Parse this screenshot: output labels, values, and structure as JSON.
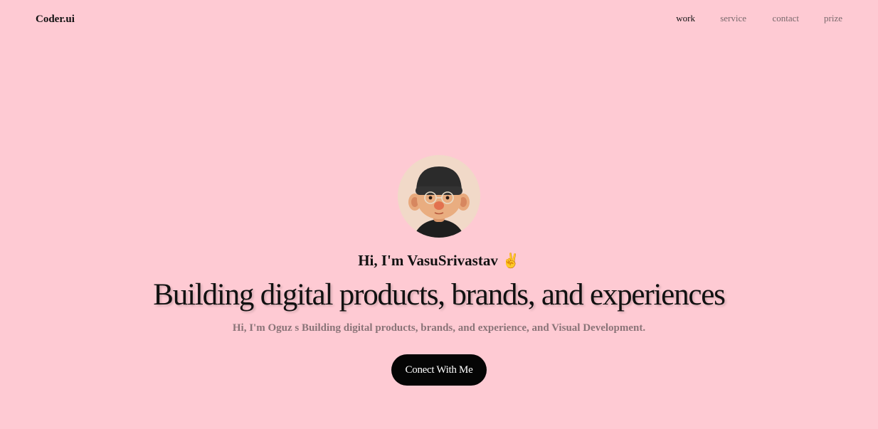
{
  "header": {
    "logo": "Coder.ui",
    "nav": [
      {
        "label": "work",
        "active": true
      },
      {
        "label": "service",
        "active": false
      },
      {
        "label": "contact",
        "active": false
      },
      {
        "label": "prize",
        "active": false
      }
    ]
  },
  "hero": {
    "avatar_icon": "3d-avatar-man-beanie-glasses",
    "greeting": "Hi, I'm VasuSrivastav",
    "greeting_emoji": "✌️",
    "headline": "Building digital products, brands, and experiences",
    "subtext": "Hi, I'm Oguz s Building digital products, brands, and experience, and Visual Development.",
    "cta_label": "Conect With Me"
  },
  "colors": {
    "background": "#fecad3",
    "button": "#050505",
    "nav_inactive": "#7a6a6d"
  }
}
